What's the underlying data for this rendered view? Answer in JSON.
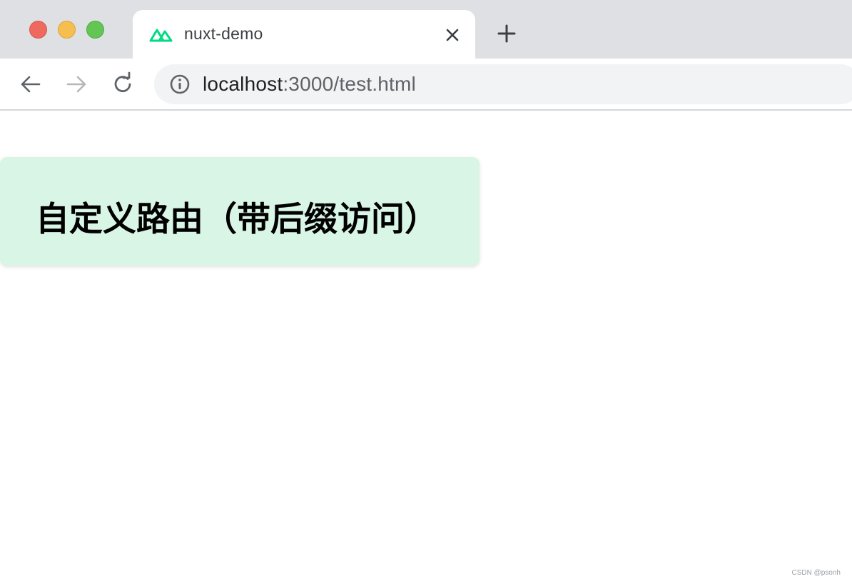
{
  "browser": {
    "tab": {
      "title": "nuxt-demo",
      "favicon": "nuxt-logo-icon"
    },
    "address": {
      "host": "localhost",
      "rest": ":3000/test.html"
    }
  },
  "page": {
    "heading": "自定义路由（带后缀访问）",
    "card_color": "#d9f5e6"
  },
  "watermark": "CSDN @psonh",
  "colors": {
    "nuxt_green": "#00dc82",
    "tabstrip": "#dfe0e4",
    "omnibox": "#f1f3f4"
  }
}
